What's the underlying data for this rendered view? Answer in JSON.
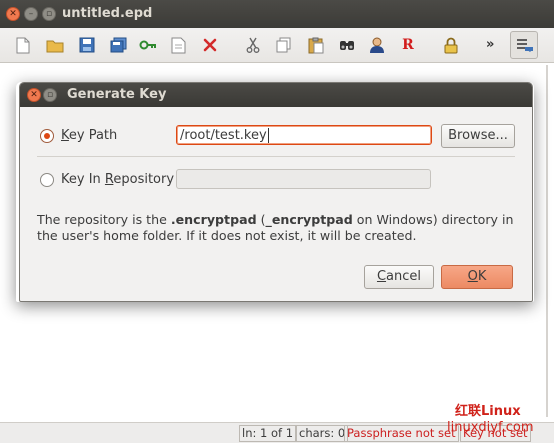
{
  "window": {
    "title": "untitled.epd"
  },
  "toolbar": {
    "icons": [
      "new-file-icon",
      "open-folder-icon",
      "save-icon",
      "save-as-icon",
      "encryption-key-icon",
      "print-icon",
      "delete-icon",
      "cut-icon",
      "copy-icon",
      "paste-icon",
      "find-icon",
      "user-icon",
      "r-icon",
      "lock-icon"
    ],
    "overflow_label": "»"
  },
  "dialog": {
    "title": "Generate Key",
    "key_path_label_prefix": "",
    "key_path_label_mnemonic": "K",
    "key_path_label_rest": "ey Path",
    "key_path_value": "/root/test.key",
    "browse_label": "Browse...",
    "key_in_repo_label_prefix": "Key In ",
    "key_in_repo_label_mnemonic": "R",
    "key_in_repo_label_rest": "epository",
    "key_in_repo_value": "",
    "description_1": "The repository is the ",
    "description_bold_1": ".encryptpad",
    "description_2": " (",
    "description_bold_2": "_encryptpad",
    "description_3": " on Windows) directory in the user's home folder. If it does not exist, it will be created.",
    "cancel_mnemonic": "C",
    "cancel_rest": "ancel",
    "ok_mnemonic": "O",
    "ok_rest": "K"
  },
  "statusbar": {
    "line": "ln: 1 of 1",
    "chars": "chars: 0",
    "passphrase": "Passphrase not set",
    "key": "Key not set"
  },
  "watermark": {
    "line1": "红联Linux",
    "line2": "linuxdiyf.com"
  },
  "colors": {
    "accent": "#dd4814",
    "title_bar": "#3c3b37",
    "status_warning": "#cc2020"
  }
}
